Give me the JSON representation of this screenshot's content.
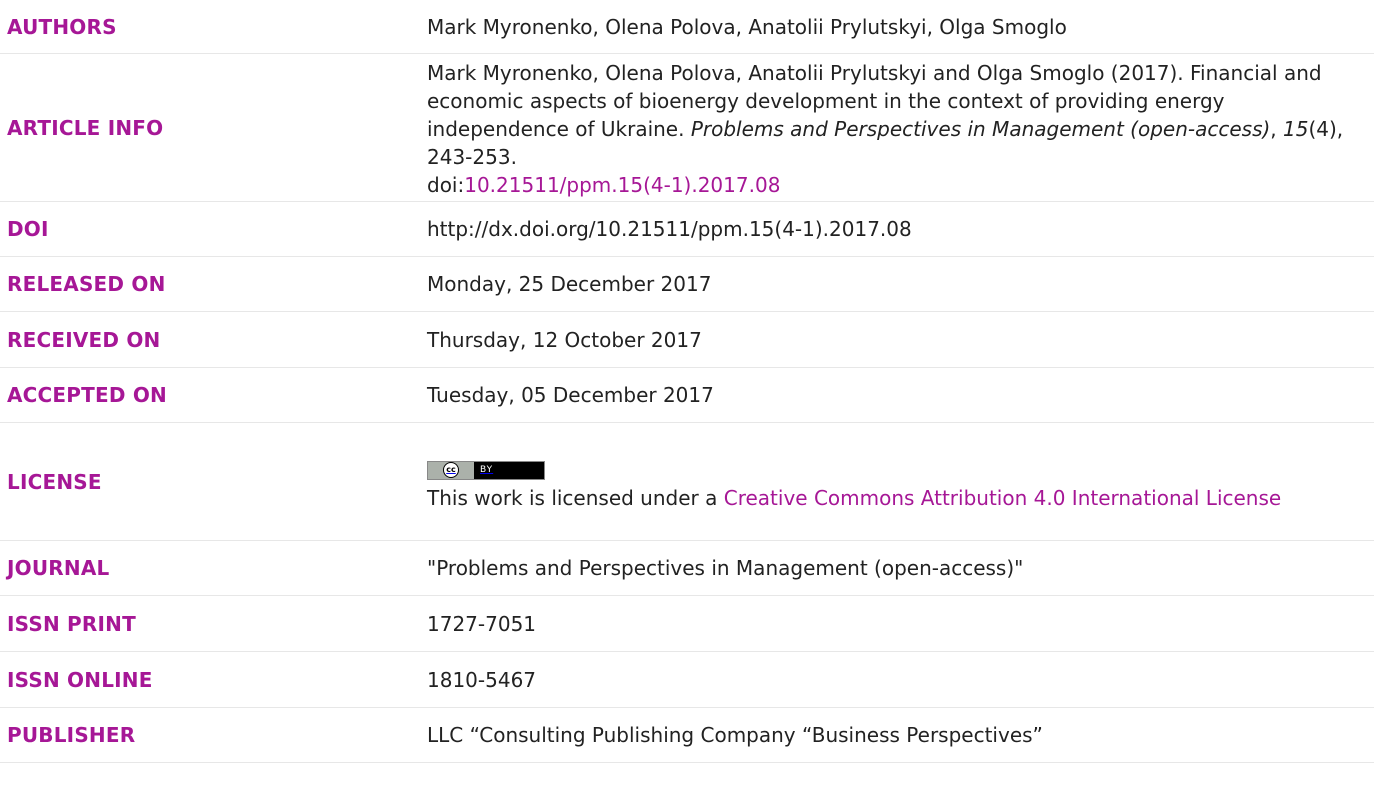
{
  "rows": {
    "authors": {
      "label": "AUTHORS",
      "value": "Mark Myronenko, Olena Polova, Anatolii Prylutskyi, Olga Smoglo"
    },
    "article_info": {
      "label": "ARTICLE INFO",
      "part1": "Mark Myronenko, Olena Polova, Anatolii Prylutskyi and Olga Smoglo (2017). Financial and economic aspects of bioenergy development in the context of providing energy independence of Ukraine. ",
      "journal_italic": "Problems and Perspectives in Management (open-access)",
      "sep1": ", ",
      "volume_italic": "15",
      "part2": "(4), 243-253.",
      "doi_prefix": "doi:",
      "doi_link": "10.21511/ppm.15(4-1).2017.08"
    },
    "doi": {
      "label": "DOI",
      "value": "http://dx.doi.org/10.21511/ppm.15(4-1).2017.08"
    },
    "released_on": {
      "label": "RELEASED ON",
      "value": "Monday, 25 December 2017"
    },
    "received_on": {
      "label": "RECEIVED ON",
      "value": "Thursday, 12 October 2017"
    },
    "accepted_on": {
      "label": "ACCEPTED ON",
      "value": "Tuesday, 05 December 2017"
    },
    "license": {
      "label": "LICENSE",
      "badge_cc": "cc",
      "badge_by": "BY",
      "prefix": "This work is licensed under a ",
      "link": "Creative Commons Attribution 4.0 International License"
    },
    "journal": {
      "label": "JOURNAL",
      "value": "\"Problems and Perspectives in Management (open-access)\""
    },
    "issn_print": {
      "label": "ISSN PRINT",
      "value": "1727-7051"
    },
    "issn_online": {
      "label": "ISSN ONLINE",
      "value": "1810-5467"
    },
    "publisher": {
      "label": "PUBLISHER",
      "value": "LLC “Consulting Publishing Company “Business Perspectives”"
    }
  },
  "colors": {
    "label": "#a61796",
    "link": "#a61796",
    "text": "#222222"
  }
}
